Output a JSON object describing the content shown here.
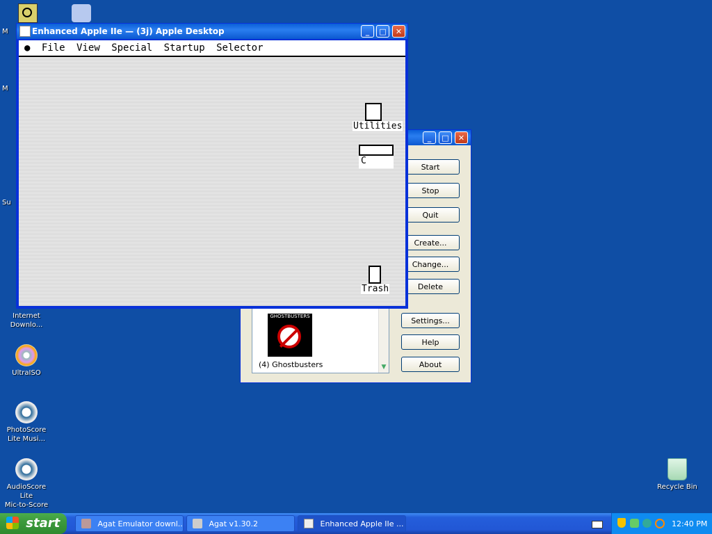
{
  "desktop": {
    "icons": [
      {
        "label": "Internet\nDownlo..."
      },
      {
        "label": "UltraISO"
      },
      {
        "label": "PhotoScore\nLite Musi..."
      },
      {
        "label": "AudioScore Lite\nMic-to-Score"
      },
      {
        "label": "Recycle Bin"
      }
    ],
    "partial": [
      "M",
      "M",
      "Su"
    ]
  },
  "apple_window": {
    "title": "Enhanced Apple IIe — (3j) Apple Desktop",
    "menu": [
      "File",
      "View",
      "Special",
      "Startup",
      "Selector"
    ],
    "icons": {
      "utilities": "Utilities",
      "disk": "C",
      "trash": "Trash"
    }
  },
  "agat_window": {
    "buttons": [
      "Start",
      "Stop",
      "Quit",
      "Create...",
      "Change...",
      "Delete",
      "Settings...",
      "Help",
      "About"
    ],
    "list_item": "(4) Ghostbusters",
    "thumb_title": "GHOSTBUSTERS"
  },
  "taskbar": {
    "start": "start",
    "tasks": [
      "Agat Emulator downl...",
      "Agat v1.30.2",
      "Enhanced Apple IIe ..."
    ],
    "clock": "12:40 PM"
  },
  "colors": {
    "desktop": "#0f4ea5",
    "titlebar": "#0a5fd8",
    "taskbar": "#245edb"
  }
}
